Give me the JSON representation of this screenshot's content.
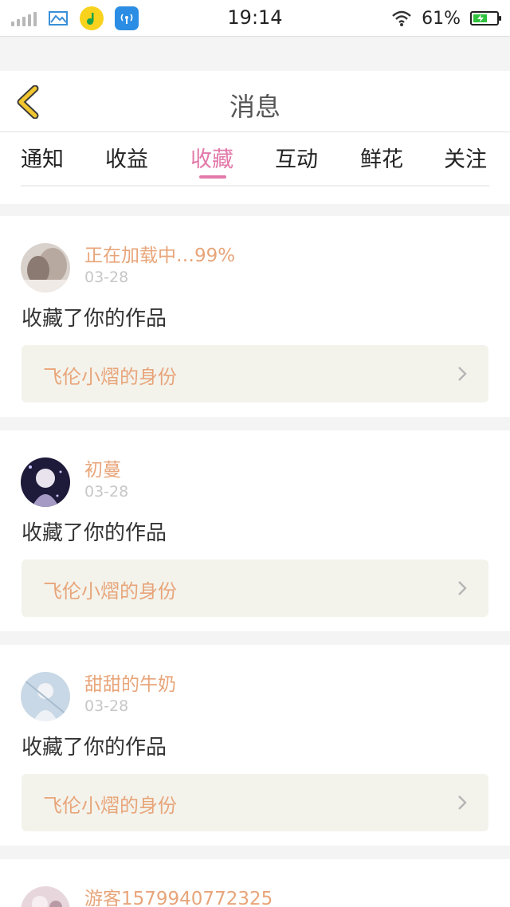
{
  "status_bar": {
    "time": "19:14",
    "battery_percent": "61%",
    "battery_level": 0.61,
    "icons": [
      "signal-icon",
      "gallery-icon",
      "qq-music-icon",
      "hotspot-app-icon",
      "wifi-icon",
      "battery-icon"
    ]
  },
  "header": {
    "title": "消息"
  },
  "tabs": [
    {
      "label": "通知"
    },
    {
      "label": "收益"
    },
    {
      "label": "收藏"
    },
    {
      "label": "互动"
    },
    {
      "label": "鲜花"
    },
    {
      "label": "关注"
    }
  ],
  "active_tab": "收藏",
  "notifications": [
    {
      "username": "正在加载中…99%",
      "date": "03-28",
      "action": "收藏了你的作品",
      "work_title": "飞伦小熠的身份"
    },
    {
      "username": "初蔓",
      "date": "03-28",
      "action": "收藏了你的作品",
      "work_title": "飞伦小熠的身份"
    },
    {
      "username": "甜甜的牛奶",
      "date": "03-28",
      "action": "收藏了你的作品",
      "work_title": "飞伦小熠的身份"
    },
    {
      "username": "游客1579940772325",
      "date": "",
      "action": "",
      "work_title": ""
    }
  ],
  "colors": {
    "accent_pink": "#e279aa",
    "username_orange": "#e8a57a",
    "back_arrow_yellow": "#f2c62f",
    "link_bg": "#f3f3ec"
  }
}
